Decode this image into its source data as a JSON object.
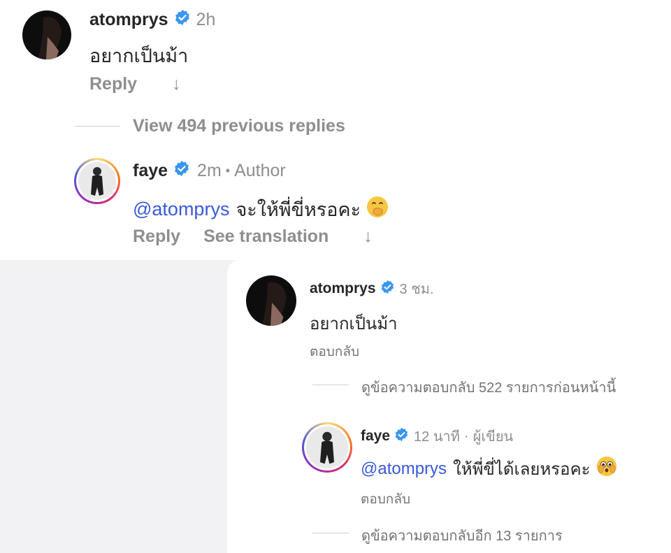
{
  "top": {
    "comment": {
      "username": "atomprys",
      "time": "2h",
      "text": "อยากเป็นม้า",
      "reply_label": "Reply",
      "arrow": "↓"
    },
    "view_replies": "View 494 previous replies",
    "reply": {
      "username": "faye",
      "time": "2m",
      "separator": "•",
      "author_badge": "Author",
      "mention": "@atomprys",
      "text": "จะให้พี่ขี่หรอคะ",
      "emoji": "hand-over-mouth-emoji",
      "reply_label": "Reply",
      "translate_label": "See translation",
      "arrow": "↓"
    }
  },
  "bottom": {
    "comment": {
      "username": "atomprys",
      "time": "3 ชม.",
      "text": "อยากเป็นม้า",
      "reply_label": "ตอบกลับ"
    },
    "view_replies": "ดูข้อความตอบกลับ 522 รายการก่อนหน้านี้",
    "reply": {
      "username": "faye",
      "time": "12 นาที",
      "separator": "·",
      "author_badge": "ผู้เขียน",
      "mention": "@atomprys",
      "text": "ให้พี่ขี่ได้เลยหรอคะ",
      "emoji": "flushed-face-emoji",
      "reply_label": "ตอบกลับ"
    },
    "more_replies": "ดูข้อความตอบกลับอีก 13 รายการ"
  },
  "colors": {
    "verified": "#3897f0",
    "mention": "#3a5ad9",
    "muted": "#8e8e8e",
    "text": "#262626",
    "backdrop": "#f2f2f4"
  }
}
